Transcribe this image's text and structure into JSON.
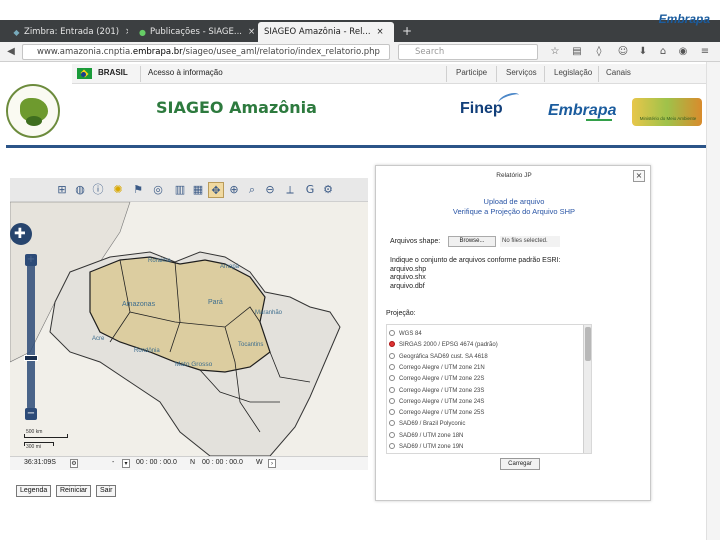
{
  "browser": {
    "tabs": [
      {
        "label": "Zimbra: Entrada (201)",
        "icon": "zimbra-icon"
      },
      {
        "label": "Publicações - SIAGE...",
        "icon": "publications-icon"
      },
      {
        "label": "SIAGEO Amazônia - Rel...",
        "icon": "page-icon"
      }
    ],
    "new_tab": "+",
    "url_prefix": "www.amazonia.cnptia.",
    "url_domain": "embrapa.br",
    "url_path": "/siageo/usee_aml/relatorio/index_relatorio.php",
    "search_placeholder": "Search",
    "corner_brand": "Embrapa"
  },
  "govbar": {
    "country": "BRASIL",
    "access": "Acesso à informação",
    "links": [
      "Participe",
      "Serviços",
      "Legislação",
      "Canais"
    ]
  },
  "header": {
    "title": "SIAGEO Amazônia",
    "finep": "Finep",
    "embrapa": "Embrapa",
    "ministerio": "Ministério do Meio Ambiente"
  },
  "map": {
    "labels": [
      "Roraima",
      "Amapá",
      "Amazonas",
      "Pará",
      "Maranhão",
      "Acre",
      "Rondônia",
      "Tocantins",
      "Mato Grosso"
    ],
    "scale_top": "500 km",
    "scale_bottom": "300 mi",
    "coord_value": "36:31:09S",
    "coord_zoom": "-",
    "coord_deg1": "00 : 00 : 00.0",
    "coord_deg2": "00 : 00 : 00.0",
    "coord_n": "N",
    "coord_w": "W"
  },
  "buttons": {
    "legenda": "Legenda",
    "reiniciar": "Reiniciar",
    "sair": "Sair"
  },
  "dialog": {
    "title": "Relatório JP",
    "close": "×",
    "upload_title": "Upload de arquivo",
    "upload_subtitle": "Verifique a Projeção do Arquivo SHP",
    "field_label": "Arquivos shape:",
    "browse": "Browse...",
    "no_file": "No files selected.",
    "instruct_lines": [
      "Indique o conjunto de arquivos conforme padrão ESRI:",
      "arquivo.shp",
      "arquivo.shx",
      "arquivo.dbf"
    ],
    "projecao_label": "Projeção:",
    "projections": [
      {
        "label": "WGS 84",
        "selected": false
      },
      {
        "label": "SIRGAS 2000 / EPSG 4674 (padrão)",
        "selected": true
      },
      {
        "label": "Geográfica SAD69 cust. SA 4618",
        "selected": false
      },
      {
        "label": "Corrego Alegre / UTM zone 21N",
        "selected": false
      },
      {
        "label": "Corrego Alegre / UTM zone 22S",
        "selected": false
      },
      {
        "label": "Corrego Alegre / UTM zone 23S",
        "selected": false
      },
      {
        "label": "Corrego Alegre / UTM zone 24S",
        "selected": false
      },
      {
        "label": "Corrego Alegre / UTM zone 25S",
        "selected": false
      },
      {
        "label": "SAD69 / Brazil Polyconic",
        "selected": false
      },
      {
        "label": "SAD69 / UTM zone 18N",
        "selected": false
      },
      {
        "label": "SAD69 / UTM zone 19N",
        "selected": false
      }
    ],
    "submit": "Carregar"
  },
  "colors": {
    "title_green": "#2d7a3e",
    "header_line": "#2b5488",
    "highlight_region": "#dccda0",
    "dialog_link": "#2b56a6"
  }
}
